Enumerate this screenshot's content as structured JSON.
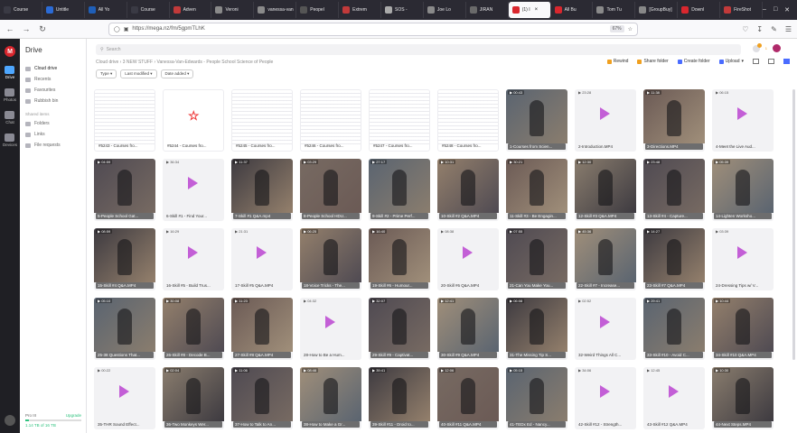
{
  "browser": {
    "tabs": [
      {
        "label": "Course",
        "color": "#3a3a44"
      },
      {
        "label": "Untitle",
        "color": "#2b6bd6"
      },
      {
        "label": "All Yo",
        "color": "#1f5fb8"
      },
      {
        "label": "Course",
        "color": "#3a3a44"
      },
      {
        "label": "Adven",
        "color": "#c23a3a"
      },
      {
        "label": "Veroni",
        "color": "#8a8a8a"
      },
      {
        "label": "vanessa-van",
        "color": "#8a8a8a"
      },
      {
        "label": "Peopel",
        "color": "#555"
      },
      {
        "label": "Extrem",
        "color": "#c23a3a"
      },
      {
        "label": "SOS - ",
        "color": "#aaa"
      },
      {
        "label": "Joe Lo",
        "color": "#8a8a8a"
      },
      {
        "label": "JIRAN",
        "color": "#6a6a6a"
      },
      {
        "label": "(1) I",
        "color": "#d9272e",
        "active": true
      },
      {
        "label": "All Bu",
        "color": "#d9272e"
      },
      {
        "label": "Tom Tu",
        "color": "#8a8a8a"
      },
      {
        "label": "[GroupBuy]",
        "color": "#888"
      },
      {
        "label": "Downl",
        "color": "#d9272e"
      },
      {
        "label": "FireShot",
        "color": "#c23a3a"
      }
    ],
    "url": "https://mega.nz/fm/5gpmTLhK",
    "zoom": "67%"
  },
  "rail": {
    "logo": "M",
    "items": [
      {
        "label": "Drive",
        "active": true
      },
      {
        "label": "Photos"
      },
      {
        "label": "Chat"
      },
      {
        "label": "Devices"
      }
    ]
  },
  "sidebar": {
    "title": "Drive",
    "items": [
      "Cloud drive",
      "Recents",
      "Favourites",
      "Rubbish bin"
    ],
    "section": "Shared items",
    "shared": [
      "Folders",
      "Links",
      "File requests"
    ],
    "storage_plan": "Pro III",
    "upgrade": "Upgrade",
    "storage_used": "1.14 TB of 16 TB",
    "storage_fraction": 0.07
  },
  "main": {
    "search_placeholder": "Search",
    "notif_count": "1",
    "breadcrumb": "Cloud drive  ›  3 NEW STUFF  ›  Vanessa-Van-Edwards - People School Science of People",
    "actions": {
      "rewind": "Rewind",
      "share": "Share folder",
      "create": "Create folder",
      "upload": "Upload"
    },
    "filters": [
      "Type",
      "Last modified",
      "Date added"
    ],
    "files": [
      {
        "name": "#5243 - Courses fro...",
        "kind": "doc"
      },
      {
        "name": "#5244 - Courses fro...",
        "kind": "pdf"
      },
      {
        "name": "#5245 - Courses fro...",
        "kind": "doc"
      },
      {
        "name": "#5246 - Courses fro...",
        "kind": "doc"
      },
      {
        "name": "#5247 - Courses fro...",
        "kind": "doc"
      },
      {
        "name": "#5248 - Courses fro...",
        "kind": "doc"
      },
      {
        "name": "1-Courses from Scien...",
        "kind": "video",
        "dur": "00:43"
      },
      {
        "name": "2-Introduction.MP4",
        "kind": "play",
        "dur": "23:28"
      },
      {
        "name": "3-Directions.MP4",
        "kind": "video",
        "dur": "11:38"
      },
      {
        "name": "4-Meet the Live Aud...",
        "kind": "play",
        "dur": "06:15"
      },
      {
        "name": "5-People School Gat...",
        "kind": "video",
        "dur": "04:59"
      },
      {
        "name": "6-Skill #1 - Find Your...",
        "kind": "play",
        "dur": "36:34"
      },
      {
        "name": "7-Skill #1 Q&A.mp4",
        "kind": "video",
        "dur": "11:37"
      },
      {
        "name": "8-People School HDU...",
        "kind": "video",
        "dur": "03:29"
      },
      {
        "name": "9-Skill #2 - Prime Perf...",
        "kind": "video",
        "dur": "27:17"
      },
      {
        "name": "10-Skill #2 Q&A.MP4",
        "kind": "video",
        "dur": "10:31"
      },
      {
        "name": "11-Skill #3 - Be Engagin...",
        "kind": "video",
        "dur": "30:21"
      },
      {
        "name": "12-Skill #3 Q&A.MP4",
        "kind": "video",
        "dur": "12:30"
      },
      {
        "name": "13-Skill #4 - Capture...",
        "kind": "video",
        "dur": "23:48"
      },
      {
        "name": "14-Lighten Worksho...",
        "kind": "video",
        "dur": "05:39"
      },
      {
        "name": "15-Skill #4 Q&A.MP4",
        "kind": "video",
        "dur": "08:59"
      },
      {
        "name": "16-Skill #5 - Build Trus...",
        "kind": "play",
        "dur": "16:29"
      },
      {
        "name": "17-Skill #5 Q&A.MP4",
        "kind": "play",
        "dur": "21:31"
      },
      {
        "name": "18-Voice Tricks - The...",
        "kind": "video",
        "dur": "06:25"
      },
      {
        "name": "19-Skill #6 - Humour...",
        "kind": "video",
        "dur": "16:40"
      },
      {
        "name": "20-Skill #6 Q&A.MP4",
        "kind": "play",
        "dur": "08:38"
      },
      {
        "name": "21-Can You Make You...",
        "kind": "video",
        "dur": "07:55"
      },
      {
        "name": "22-Skill #7 - Increase...",
        "kind": "video",
        "dur": "45:36"
      },
      {
        "name": "23-Skill #7 Q&A.MP4",
        "kind": "video",
        "dur": "14:27"
      },
      {
        "name": "24-Dressing Tips w/ V...",
        "kind": "play",
        "dur": "03:39"
      },
      {
        "name": "25-38 Questions That...",
        "kind": "video",
        "dur": "05:10"
      },
      {
        "name": "26-Skill #8 - Decode B...",
        "kind": "video",
        "dur": "30:08"
      },
      {
        "name": "27-Skill #8 Q&A.MP4",
        "kind": "video",
        "dur": "11:23"
      },
      {
        "name": "28-How to Be a Hum...",
        "kind": "play",
        "dur": "04:32"
      },
      {
        "name": "29-Skill #9 - Captivat...",
        "kind": "video",
        "dur": "32:07"
      },
      {
        "name": "30-Skill #9 Q&A.MP4",
        "kind": "video",
        "dur": "12:41"
      },
      {
        "name": "31-The Missing Tip S...",
        "kind": "video",
        "dur": "06:08"
      },
      {
        "name": "32-Weird Things All C...",
        "kind": "play",
        "dur": "02:52"
      },
      {
        "name": "33-Skill #10 - Avoid C...",
        "kind": "video",
        "dur": "29:41"
      },
      {
        "name": "34-Skill #10 Q&A.MP4",
        "kind": "video",
        "dur": "10:44"
      },
      {
        "name": "35-THR Sound Effect...",
        "kind": "play",
        "dur": "00:22"
      },
      {
        "name": "36-Two Monkeys Wer...",
        "kind": "video",
        "dur": "02:04"
      },
      {
        "name": "37-How to Talk to An...",
        "kind": "video",
        "dur": "11:06"
      },
      {
        "name": "38-How to Make a Gr...",
        "kind": "video",
        "dur": "08:46"
      },
      {
        "name": "39-Skill #11 - Droid to...",
        "kind": "video",
        "dur": "39:41"
      },
      {
        "name": "40-Skill #11 Q&A.MP4",
        "kind": "video",
        "dur": "12:06"
      },
      {
        "name": "41-TEDx Ed - Nancy...",
        "kind": "video",
        "dur": "05:15"
      },
      {
        "name": "42-Skill #12 - Strength...",
        "kind": "play",
        "dur": "34:06"
      },
      {
        "name": "43-Skill #12 Q&A.MP4",
        "kind": "play",
        "dur": "12:45"
      },
      {
        "name": "44-Next Steps.MP4",
        "kind": "video",
        "dur": "10:30"
      }
    ]
  },
  "colors": {
    "accent": "#d9272e",
    "play": "#c35fd6",
    "view_active": "#4a6cff"
  }
}
